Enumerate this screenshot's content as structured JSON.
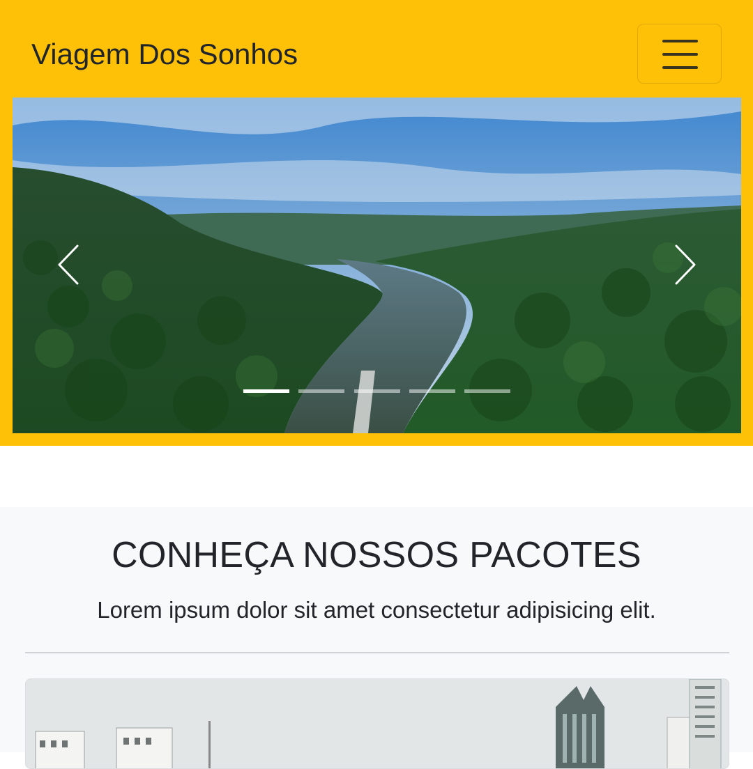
{
  "navbar": {
    "brand": "Viagem Dos Sonhos",
    "menu_icon": "hamburger-menu-icon",
    "background": "#ffc107"
  },
  "carousel": {
    "slide_count": 5,
    "active_index": 0,
    "prev_icon": "chevron-left-icon",
    "next_icon": "chevron-right-icon",
    "image": "river-valley-aerial-photo"
  },
  "packages": {
    "title": "CONHEÇA NOSSOS PACOTES",
    "subtitle": "Lorem ipsum dolor sit amet consectetur adipisicing elit.",
    "card_image": "city-buildings-photo"
  }
}
